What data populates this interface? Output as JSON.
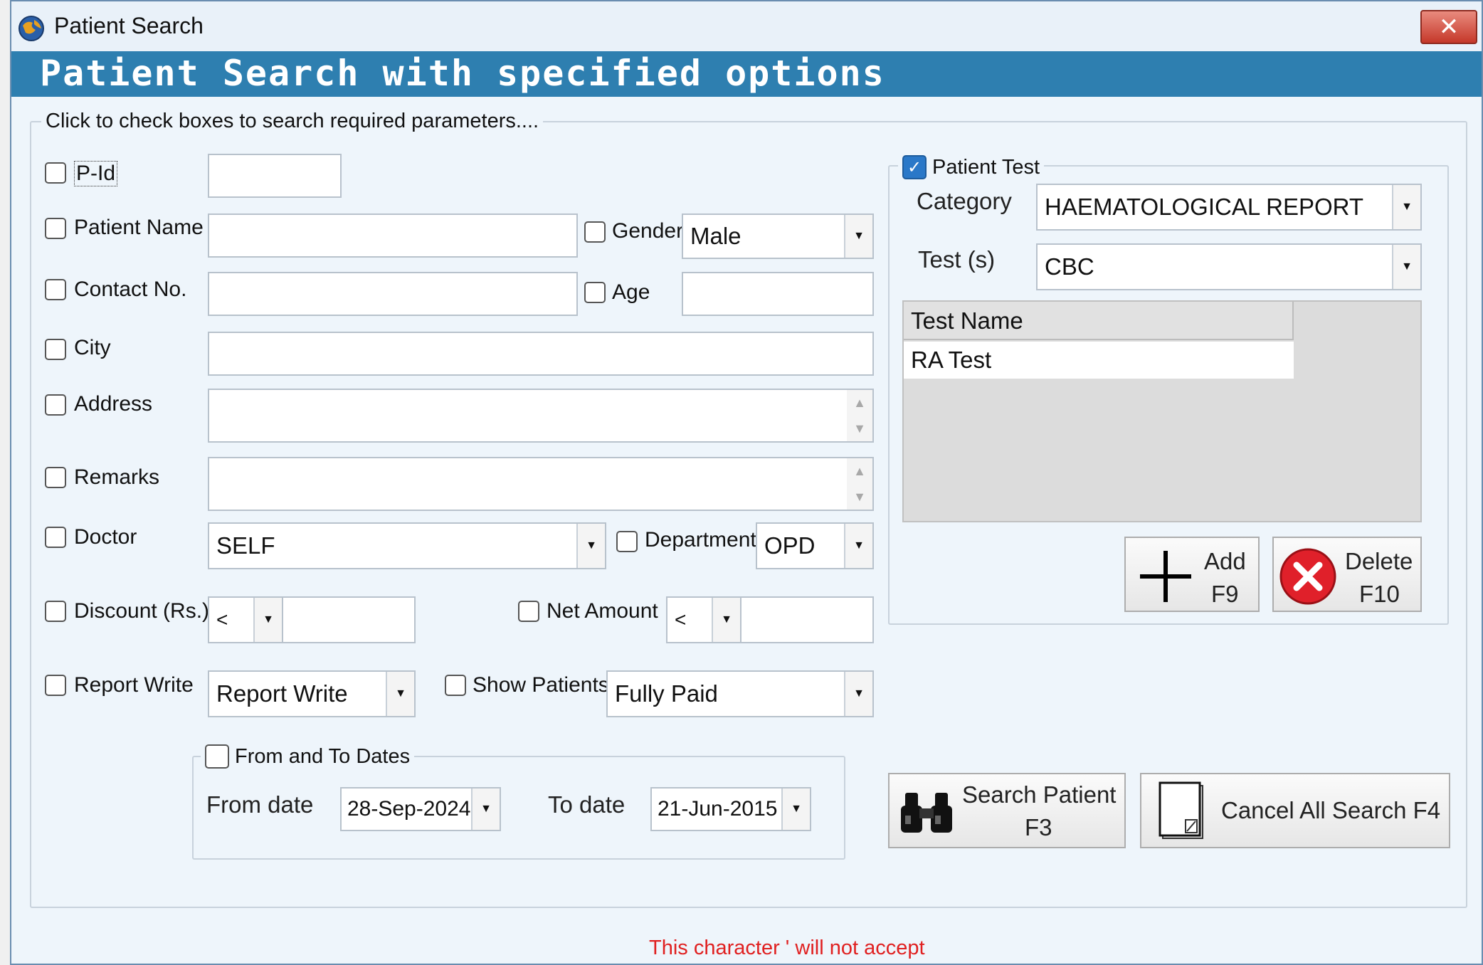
{
  "window": {
    "title": "Patient Search",
    "close_glyph": "✕",
    "banner": "Patient Search with specified options"
  },
  "main_group": {
    "legend": "Click to check boxes to search required parameters...."
  },
  "fields": {
    "pid": {
      "label": "P-Id",
      "value": ""
    },
    "patient_name": {
      "label": "Patient Name",
      "value": ""
    },
    "gender": {
      "label": "Gender",
      "value": "Male"
    },
    "contact_no": {
      "label": "Contact No.",
      "value": ""
    },
    "age": {
      "label": "Age",
      "value": ""
    },
    "city": {
      "label": "City",
      "value": ""
    },
    "address": {
      "label": "Address",
      "value": ""
    },
    "remarks": {
      "label": "Remarks",
      "value": ""
    },
    "doctor": {
      "label": "Doctor",
      "value": "SELF"
    },
    "department": {
      "label": "Department",
      "value": "OPD"
    },
    "discount": {
      "label": "Discount (Rs.)",
      "operator": "<",
      "value": ""
    },
    "net_amount": {
      "label": "Net Amount",
      "operator": "<",
      "value": ""
    },
    "report_write": {
      "label": "Report Write",
      "value": "Report Write"
    },
    "show_patients": {
      "label": "Show Patients",
      "value": "Fully Paid"
    }
  },
  "dates": {
    "legend": "From and To Dates",
    "from_label": "From date",
    "from_value": "28-Sep-2024",
    "to_label": "To date",
    "to_value": "21-Jun-2015"
  },
  "patient_test": {
    "legend": "Patient Test",
    "checked": true,
    "category_label": "Category",
    "category_value": "HAEMATOLOGICAL REPORT",
    "tests_label": "Test (s)",
    "tests_value": "CBC",
    "grid_header": "Test Name",
    "grid_rows": [
      "RA Test"
    ],
    "add_label": "Add",
    "add_key": "F9",
    "delete_label": "Delete",
    "delete_key": "F10"
  },
  "actions": {
    "search_label": "Search Patient",
    "search_key": "F3",
    "cancel_label": "Cancel All Search F4"
  },
  "status": {
    "message": "This character ' will not accept"
  },
  "icons": {
    "app": "app-globe-icon",
    "add": "plus-icon",
    "delete": "red-x-icon",
    "search": "binoculars-icon",
    "cancel": "document-icon",
    "check": "✓",
    "dropdown": "▼"
  },
  "colors": {
    "banner": "#2e7fb0",
    "status_text": "#e02020",
    "checkbox_checked": "#2a78c8"
  }
}
